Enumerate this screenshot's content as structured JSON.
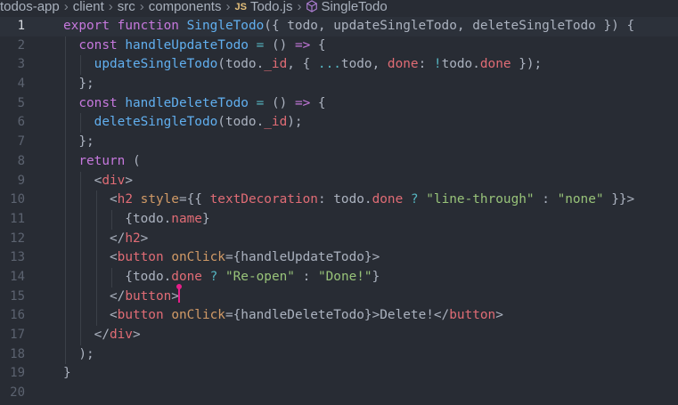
{
  "breadcrumb": {
    "items": [
      "todos-app",
      "client",
      "src",
      "components"
    ],
    "file_badge": "JS",
    "file": "Todo.js",
    "symbol": "SingleTodo",
    "separator": "›"
  },
  "active_line": 1,
  "lines": [
    {
      "n": "1",
      "tokens": [
        [
          "kw",
          "export "
        ],
        [
          "kw",
          "function "
        ],
        [
          "fn",
          "SingleTodo"
        ],
        [
          "pl",
          "({ todo, updateSingleTodo, deleteSingleTodo }) {"
        ]
      ]
    },
    {
      "n": "2",
      "tokens": [
        [
          "kw",
          "  const "
        ],
        [
          "fn",
          "handleUpdateTodo"
        ],
        [
          "pl",
          " "
        ],
        [
          "op",
          "="
        ],
        [
          "pl",
          " () "
        ],
        [
          "kw",
          "=>"
        ],
        [
          "pl",
          " {"
        ]
      ]
    },
    {
      "n": "3",
      "tokens": [
        [
          "fn",
          "    updateSingleTodo"
        ],
        [
          "pl",
          "(todo."
        ],
        [
          "prop",
          "_id"
        ],
        [
          "pl",
          ", { "
        ],
        [
          "op",
          "..."
        ],
        [
          "pl",
          "todo, "
        ],
        [
          "prop",
          "done"
        ],
        [
          "pl",
          ": "
        ],
        [
          "op",
          "!"
        ],
        [
          "pl",
          "todo."
        ],
        [
          "prop",
          "done"
        ],
        [
          "pl",
          " });"
        ]
      ]
    },
    {
      "n": "4",
      "tokens": [
        [
          "pl",
          "  };"
        ]
      ]
    },
    {
      "n": "5",
      "tokens": [
        [
          "kw",
          "  const "
        ],
        [
          "fn",
          "handleDeleteTodo"
        ],
        [
          "pl",
          " "
        ],
        [
          "op",
          "="
        ],
        [
          "pl",
          " () "
        ],
        [
          "kw",
          "=>"
        ],
        [
          "pl",
          " {"
        ]
      ]
    },
    {
      "n": "6",
      "tokens": [
        [
          "fn",
          "    deleteSingleTodo"
        ],
        [
          "pl",
          "(todo."
        ],
        [
          "prop",
          "_id"
        ],
        [
          "pl",
          ");"
        ]
      ]
    },
    {
      "n": "7",
      "tokens": [
        [
          "pl",
          "  };"
        ]
      ]
    },
    {
      "n": "8",
      "tokens": [
        [
          "kw",
          "  return "
        ],
        [
          "pl",
          "("
        ]
      ]
    },
    {
      "n": "9",
      "tokens": [
        [
          "pl",
          "    <"
        ],
        [
          "tag",
          "div"
        ],
        [
          "pl",
          ">"
        ]
      ]
    },
    {
      "n": "10",
      "tokens": [
        [
          "pl",
          "      <"
        ],
        [
          "tag",
          "h2"
        ],
        [
          "pl",
          " "
        ],
        [
          "attr",
          "style"
        ],
        [
          "pl",
          "={{ "
        ],
        [
          "prop",
          "textDecoration"
        ],
        [
          "pl",
          ": todo."
        ],
        [
          "prop",
          "done"
        ],
        [
          "pl",
          " "
        ],
        [
          "op",
          "?"
        ],
        [
          "pl",
          " "
        ],
        [
          "str",
          "\"line-through\""
        ],
        [
          "pl",
          " : "
        ],
        [
          "str",
          "\"none\""
        ],
        [
          "pl",
          " }}>"
        ]
      ]
    },
    {
      "n": "11",
      "tokens": [
        [
          "pl",
          "        {todo."
        ],
        [
          "prop",
          "name"
        ],
        [
          "pl",
          "}"
        ]
      ]
    },
    {
      "n": "12",
      "tokens": [
        [
          "pl",
          "      </"
        ],
        [
          "tag",
          "h2"
        ],
        [
          "pl",
          ">"
        ]
      ]
    },
    {
      "n": "13",
      "tokens": [
        [
          "pl",
          "      <"
        ],
        [
          "tag",
          "button"
        ],
        [
          "pl",
          " "
        ],
        [
          "attr",
          "onClick"
        ],
        [
          "pl",
          "={handleUpdateTodo}>"
        ]
      ]
    },
    {
      "n": "14",
      "tokens": [
        [
          "pl",
          "        {todo."
        ],
        [
          "prop",
          "done"
        ],
        [
          "pl",
          " "
        ],
        [
          "op",
          "?"
        ],
        [
          "pl",
          " "
        ],
        [
          "str",
          "\"Re-open\""
        ],
        [
          "pl",
          " : "
        ],
        [
          "str",
          "\"Done!\""
        ],
        [
          "pl",
          "}"
        ]
      ]
    },
    {
      "n": "15",
      "tokens": [
        [
          "pl",
          "      </"
        ],
        [
          "tag",
          "button"
        ],
        [
          "pl",
          ">"
        ]
      ]
    },
    {
      "n": "16",
      "tokens": [
        [
          "pl",
          "      <"
        ],
        [
          "tag",
          "button"
        ],
        [
          "pl",
          " "
        ],
        [
          "attr",
          "onClick"
        ],
        [
          "pl",
          "={handleDeleteTodo}>Delete!</"
        ],
        [
          "tag",
          "button"
        ],
        [
          "pl",
          ">"
        ]
      ]
    },
    {
      "n": "17",
      "tokens": [
        [
          "pl",
          "    </"
        ],
        [
          "tag",
          "div"
        ],
        [
          "pl",
          ">"
        ]
      ]
    },
    {
      "n": "18",
      "tokens": [
        [
          "pl",
          "  );"
        ]
      ]
    },
    {
      "n": "19",
      "tokens": [
        [
          "pl",
          "}"
        ]
      ]
    },
    {
      "n": "20",
      "tokens": [
        [
          "pl",
          ""
        ]
      ]
    }
  ]
}
